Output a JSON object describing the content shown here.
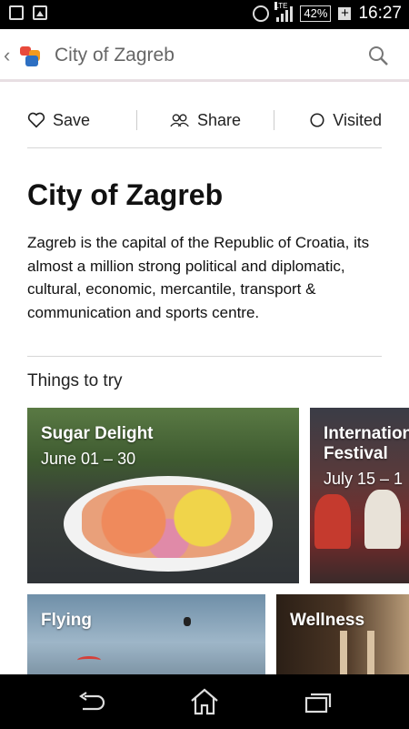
{
  "status_bar": {
    "battery": "42%",
    "network": "LTE",
    "time": "16:27"
  },
  "app_bar": {
    "title": "City of Zagreb"
  },
  "actions": {
    "save": "Save",
    "share": "Share",
    "visited": "Visited"
  },
  "article": {
    "heading": "City of Zagreb",
    "description": "Zagreb is the capital of the Republic of Croatia, its almost a million strong political and diplomatic, cultural, economic, mercantile, transport & communication and sports centre."
  },
  "things_to_try": {
    "title": "Things to try",
    "cards": [
      {
        "title": "Sugar Delight",
        "date": "June 01 – 30"
      },
      {
        "title": "International Festival",
        "date": "July 15 – 1"
      },
      {
        "title": "Flying",
        "date": ""
      },
      {
        "title": "Wellness",
        "date": ""
      }
    ]
  }
}
